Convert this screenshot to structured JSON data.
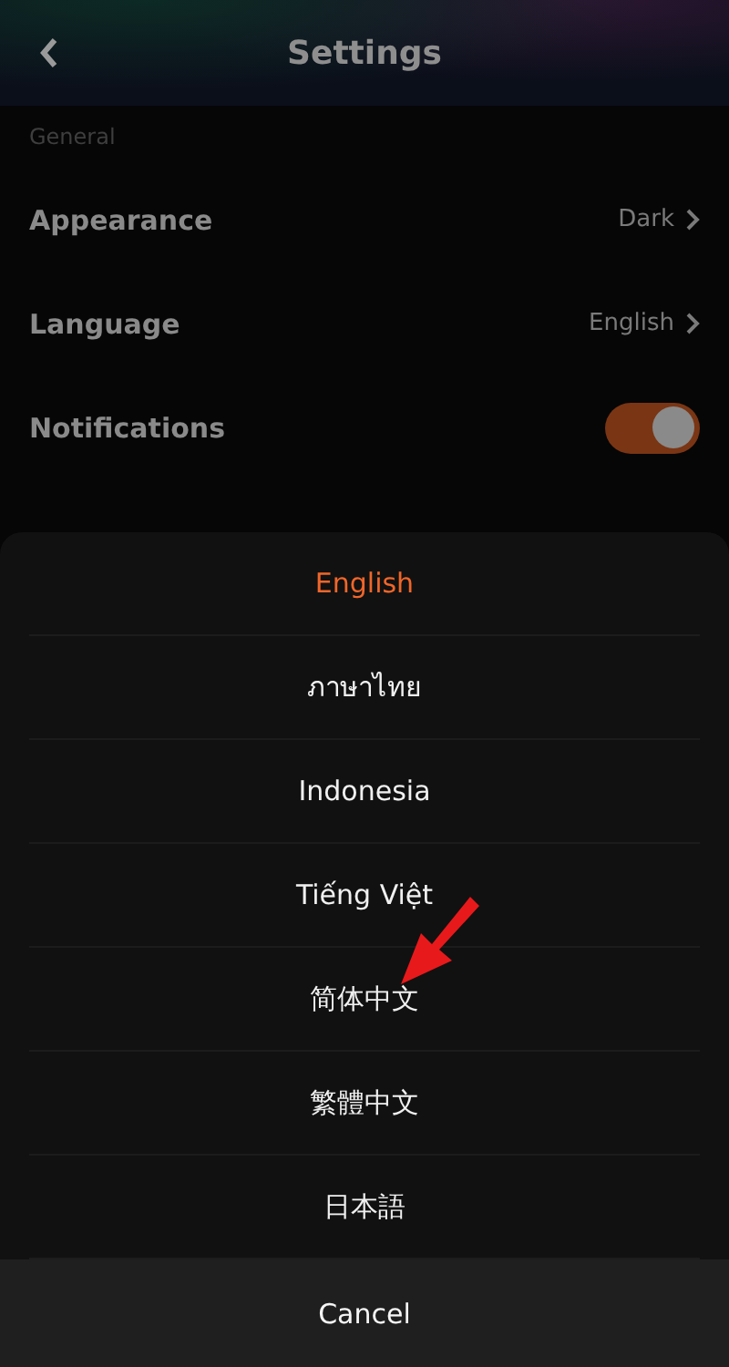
{
  "header": {
    "title": "Settings"
  },
  "section": "General",
  "settings": [
    {
      "kind": "link",
      "label": "Appearance",
      "value": "Dark"
    },
    {
      "kind": "link",
      "label": "Language",
      "value": "English"
    },
    {
      "kind": "toggle",
      "label": "Notifications",
      "on": true
    }
  ],
  "language_sheet": {
    "options": [
      {
        "label": "English",
        "selected": true
      },
      {
        "label": "ภาษาไทย",
        "selected": false
      },
      {
        "label": "Indonesia",
        "selected": false
      },
      {
        "label": "Tiếng Việt",
        "selected": false
      },
      {
        "label": "简体中文",
        "selected": false
      },
      {
        "label": "繁體中文",
        "selected": false
      },
      {
        "label": "日本語",
        "selected": false
      }
    ],
    "cancel": "Cancel"
  }
}
